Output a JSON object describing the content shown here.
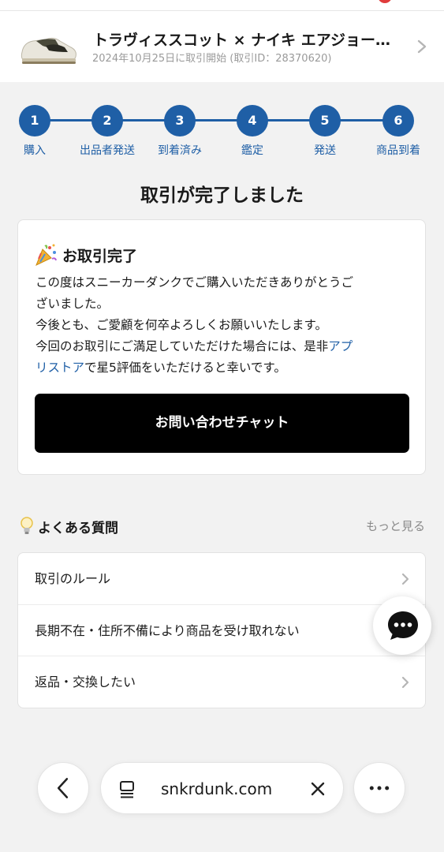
{
  "product": {
    "title": "トラヴィススコット × ナイキ エアジョー…",
    "subtitle": "2024年10月25日に取引開始 (取引ID：28370620)"
  },
  "steps": [
    {
      "num": "1",
      "label": "購入"
    },
    {
      "num": "2",
      "label": "出品者発送"
    },
    {
      "num": "3",
      "label": "到着済み"
    },
    {
      "num": "4",
      "label": "鑑定"
    },
    {
      "num": "5",
      "label": "発送"
    },
    {
      "num": "6",
      "label": "商品到着"
    }
  ],
  "status_title": "取引が完了しました",
  "card": {
    "heading": "お取引完了",
    "line1": "この度はスニーカーダンクでご購入いただきありがとうご",
    "line2": "ざいました。",
    "line3": "今後とも、ご愛顧を何卒よろしくお願いいたします。",
    "line4_prefix": "今回のお取引にご満足していただけた場合には、是非",
    "line4_link": "アプ",
    "line5_link": "リストア",
    "line5_suffix": "で星5評価をいただけると幸いです。",
    "chat_button": "お問い合わせチャット"
  },
  "faq": {
    "title": "よくある質問",
    "more": "もっと見る",
    "items": [
      {
        "label": "取引のルール"
      },
      {
        "label": "長期不在・住所不備により商品を受け取れない"
      },
      {
        "label": "返品・交換したい"
      }
    ]
  },
  "browser": {
    "url": "snkrdunk.com"
  },
  "colors": {
    "accent": "#1f5fa6",
    "button": "#000000",
    "background": "#f2f2f2"
  }
}
